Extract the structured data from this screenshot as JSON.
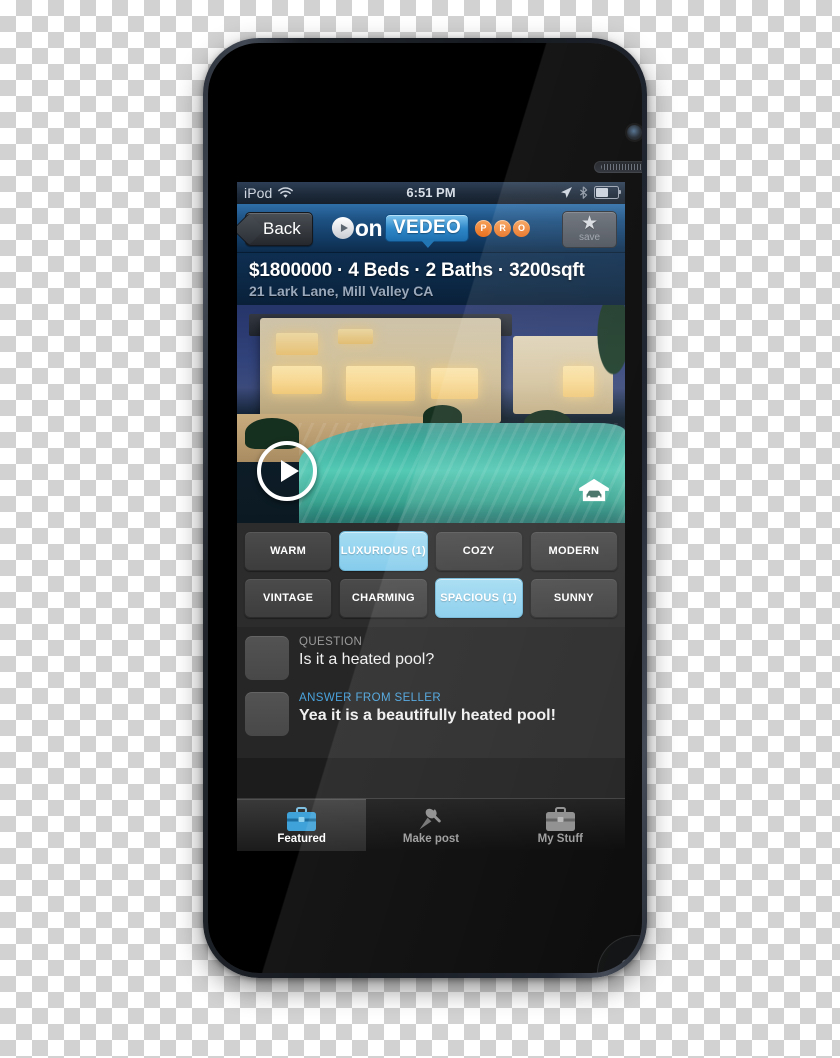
{
  "device": {
    "name": "iPod touch",
    "camera_icon": "front-camera",
    "speaker_icon": "earpiece-speaker",
    "home_button_icon": "home-button"
  },
  "status_bar": {
    "carrier": "iPod",
    "wifi_icon": "wifi-icon",
    "time": "6:51 PM",
    "location_icon": "location-arrow-icon",
    "bluetooth_icon": "bluetooth-icon",
    "battery_icon": "battery-icon"
  },
  "nav_bar": {
    "back_label": "Back",
    "logo": {
      "word_on": "on",
      "word_vedeo": "VEDEO",
      "pro_letters": [
        "P",
        "R",
        "O"
      ],
      "play_icon": "play-icon"
    },
    "save": {
      "icon": "star-icon",
      "label": "save"
    }
  },
  "listing": {
    "summary": "$1800000 · 4 Beds · 2 Baths · 3200sqft",
    "address": "21 Lark Lane, Mill Valley CA",
    "price": "$1800000",
    "beds": "4 Beds",
    "baths": "2 Baths",
    "size": "3200sqft"
  },
  "media": {
    "play_icon": "play-circle-icon",
    "garage_icon": "garage-car-icon",
    "alt": "Luxury home exterior at dusk with swimming pool"
  },
  "tags": {
    "rows": [
      [
        {
          "label": "WARM",
          "selected": false
        },
        {
          "label": "LUXURIOUS (1)",
          "selected": true
        },
        {
          "label": "COZY",
          "selected": false
        },
        {
          "label": "MODERN",
          "selected": false
        }
      ],
      [
        {
          "label": "VINTAGE",
          "selected": false
        },
        {
          "label": "CHARMING",
          "selected": false
        },
        {
          "label": "SPACIOUS (1)",
          "selected": true
        },
        {
          "label": "SUNNY",
          "selected": false
        }
      ]
    ],
    "selected_color": "#8fd2ef",
    "default_color": "#454545"
  },
  "qa": {
    "question": {
      "label": "QUESTION",
      "text": "Is it a heated pool?",
      "thumb_icon": "user-avatar-placeholder"
    },
    "answer": {
      "label": "ANSWER FROM SELLER",
      "label_color": "#4aa3dd",
      "text": "Yea it is a beautifully heated pool!",
      "thumb_icon": "user-avatar-placeholder"
    }
  },
  "tab_bar": {
    "items": [
      {
        "label": "Featured",
        "icon": "briefcase-icon",
        "active": true
      },
      {
        "label": "Make post",
        "icon": "pushpin-icon",
        "active": false
      },
      {
        "label": "My Stuff",
        "icon": "briefcase-icon",
        "active": false
      }
    ]
  }
}
